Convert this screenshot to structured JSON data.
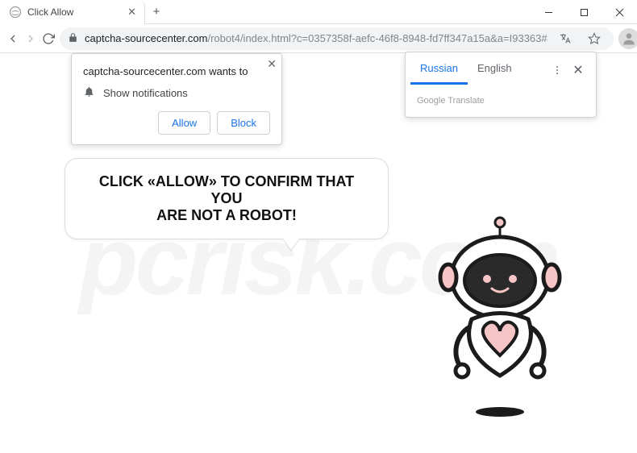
{
  "tab": {
    "title": "Click Allow"
  },
  "url": {
    "domain": "captcha-sourcecenter.com",
    "path": "/robot4/index.html?c=0357358f-aefc-46f8-8948-fd7ff347a15a&a=I93363#"
  },
  "notification": {
    "site": "captcha-sourcecenter.com wants to",
    "permission": "Show notifications",
    "allow": "Allow",
    "block": "Block"
  },
  "translate": {
    "tabs": [
      "Russian",
      "English"
    ],
    "active": 0,
    "brandPrefix": "Google",
    "brandSuffix": " Translate"
  },
  "bubble": {
    "line1": "CLICK «ALLOW» TO CONFIRM THAT YOU",
    "line2": "ARE NOT A ROBOT!"
  },
  "watermark": "pcrisk.com"
}
